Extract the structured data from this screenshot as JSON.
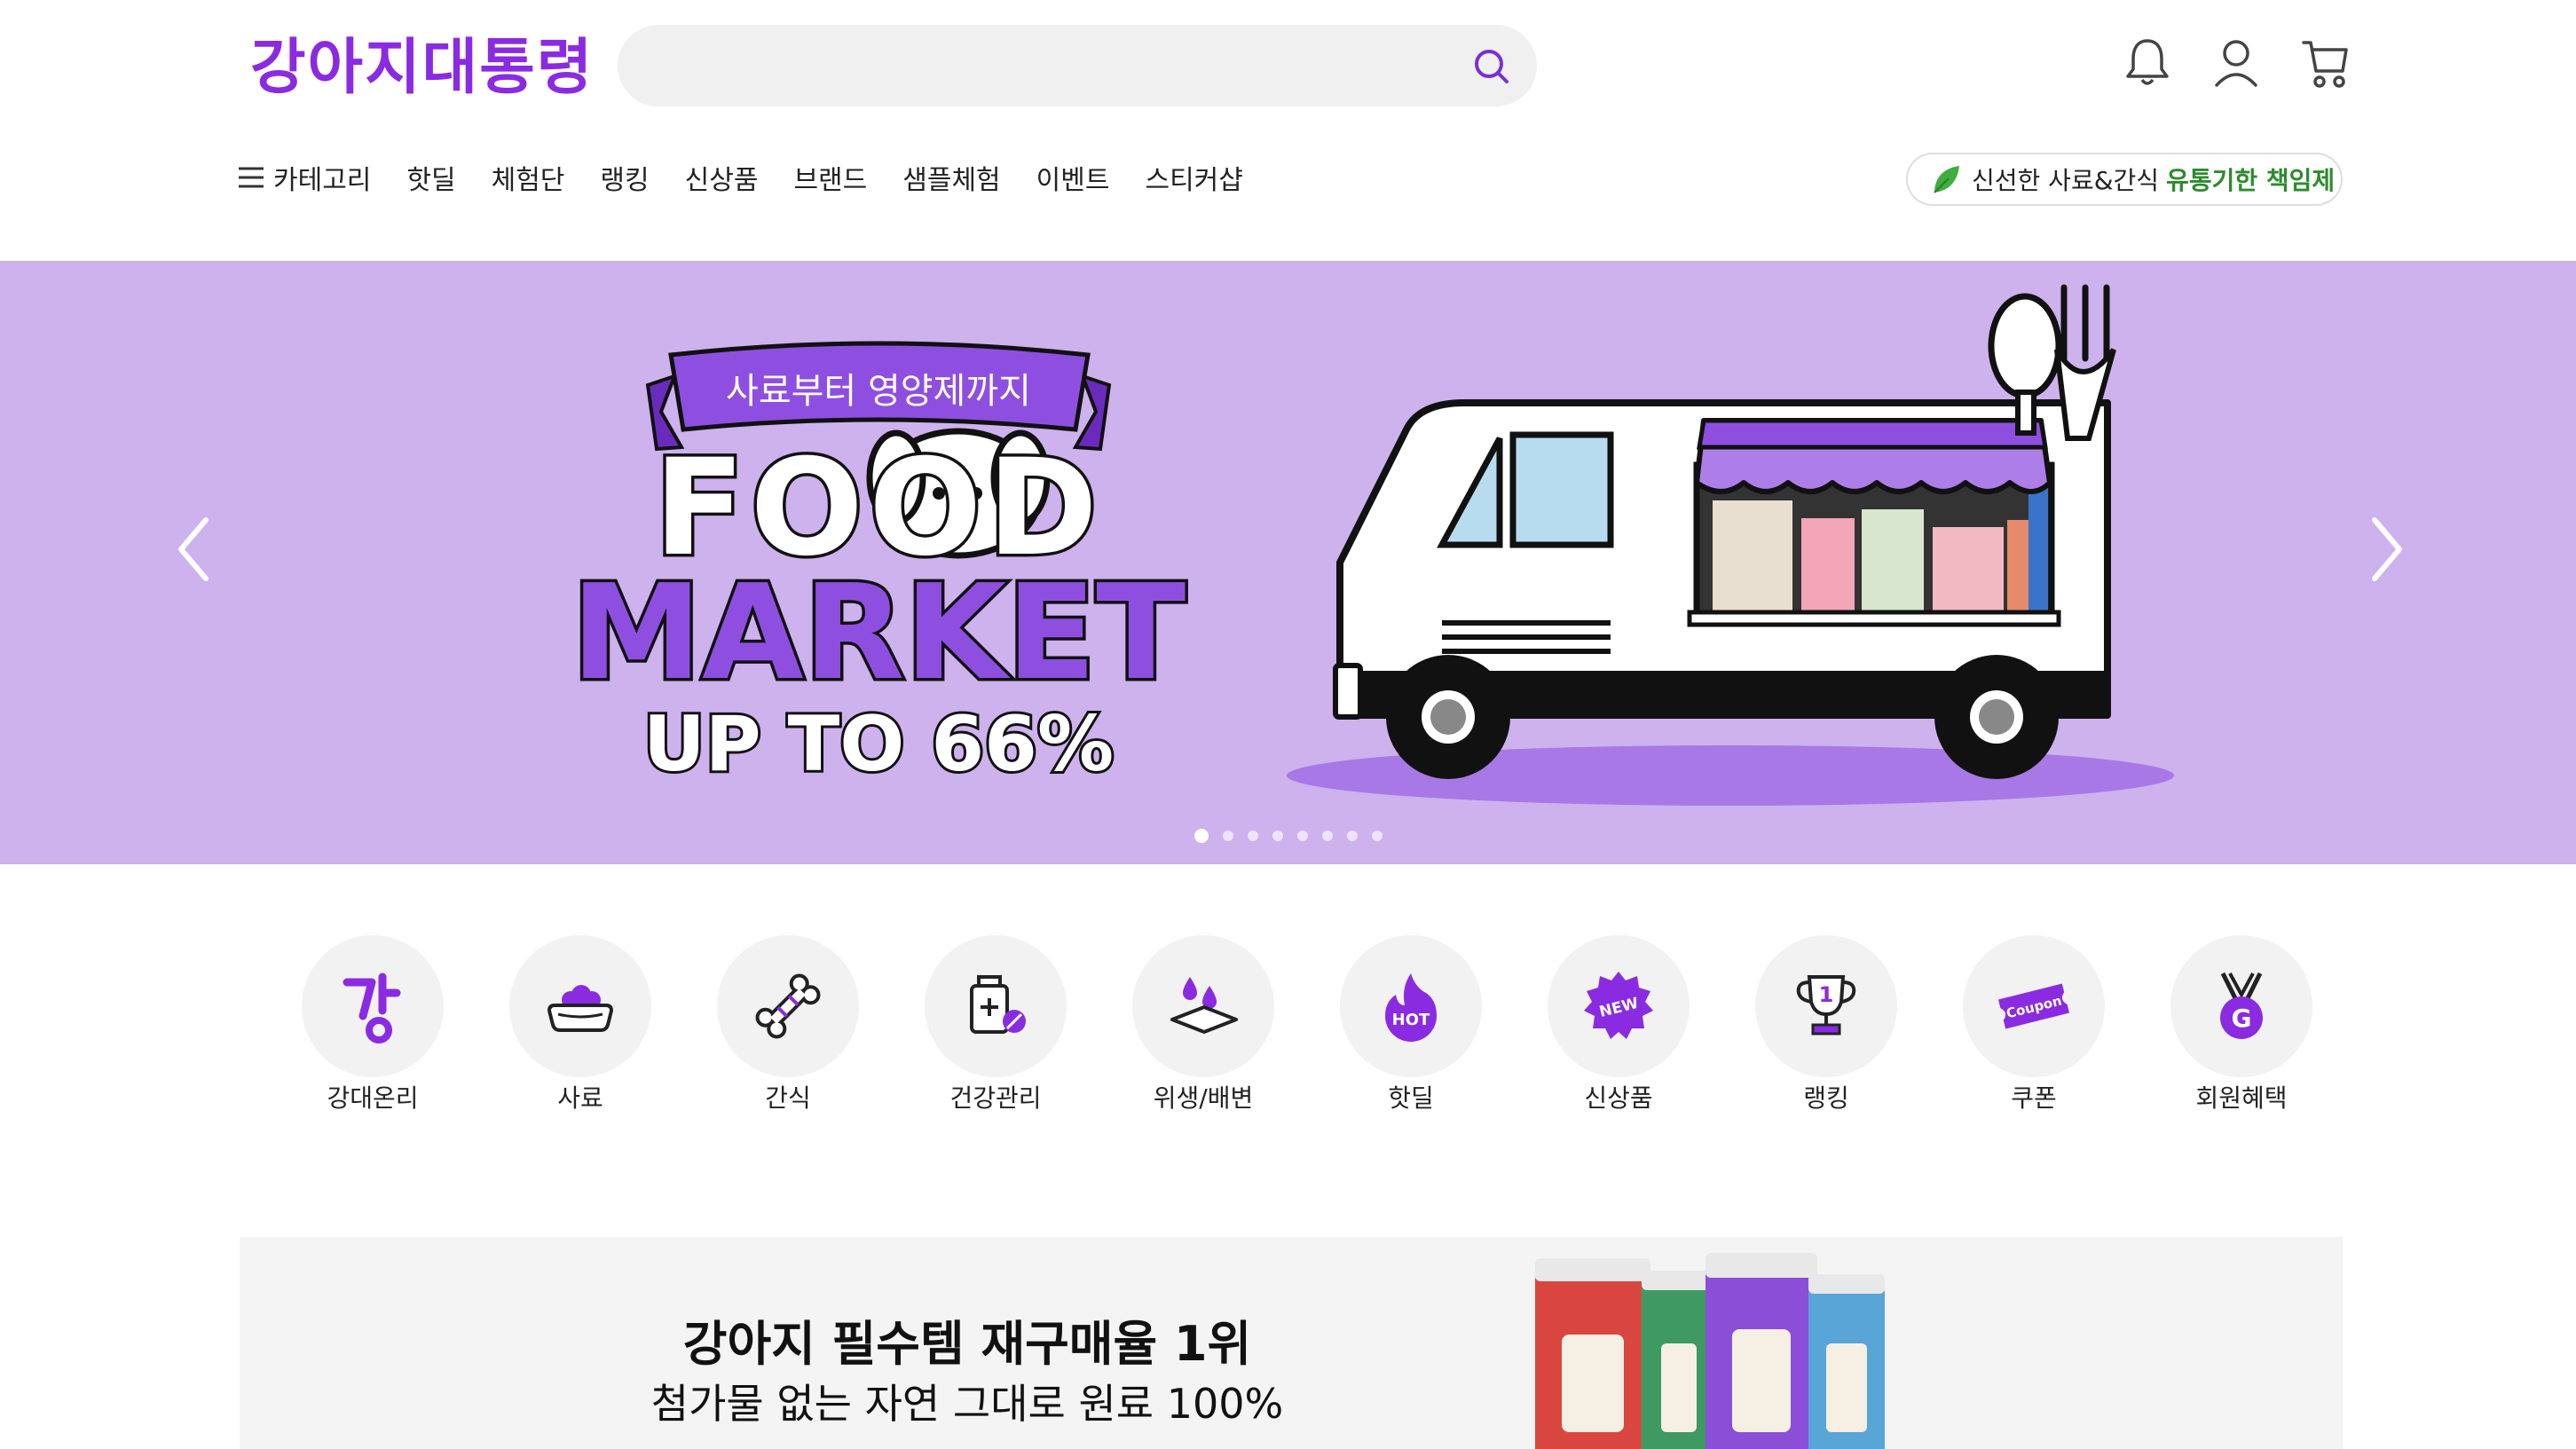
{
  "header": {
    "logo": "강아지대통령",
    "search_placeholder": "",
    "icons": [
      "bell-icon",
      "user-icon",
      "cart-icon"
    ]
  },
  "nav": {
    "items": [
      {
        "label": "카테고리",
        "icon": "hamburger-icon"
      },
      {
        "label": "핫딜"
      },
      {
        "label": "체험단"
      },
      {
        "label": "랭킹"
      },
      {
        "label": "신상품"
      },
      {
        "label": "브랜드"
      },
      {
        "label": "샘플체험"
      },
      {
        "label": "이벤트"
      },
      {
        "label": "스티커샵"
      }
    ],
    "fresh_badge": {
      "text": "신선한 사료&간식",
      "highlight": "유통기한 책임제",
      "icon": "leaf-icon"
    }
  },
  "banner": {
    "ribbon": "사료부터 영양제까지",
    "title_line1": "FOOD",
    "title_line2": "MARKET",
    "discount": "UP TO 66%",
    "slide_count": 8,
    "active_slide": 1,
    "background": "#cdb2ee",
    "accent": "#8e4fe0"
  },
  "categories": [
    {
      "label": "강대온리",
      "icon": "gang-logo-icon"
    },
    {
      "label": "사료",
      "icon": "food-bowl-icon"
    },
    {
      "label": "간식",
      "icon": "bone-icon"
    },
    {
      "label": "건강관리",
      "icon": "medicine-icon"
    },
    {
      "label": "위생/배변",
      "icon": "pee-pad-icon"
    },
    {
      "label": "핫딜",
      "icon": "hot-flame-icon",
      "badge": "HOT"
    },
    {
      "label": "신상품",
      "icon": "new-badge-icon",
      "badge": "NEW"
    },
    {
      "label": "랭킹",
      "icon": "trophy-icon",
      "badge": "1"
    },
    {
      "label": "쿠폰",
      "icon": "coupon-icon",
      "badge": "Coupon"
    },
    {
      "label": "회원혜택",
      "icon": "medal-icon",
      "badge": "G"
    }
  ],
  "promo": {
    "title": "강아지 필수템 재구매율 1위",
    "subtitle": "첨가물 없는 자연 그대로 원료 100%"
  },
  "colors": {
    "brand": "#8a2be2",
    "accent_purple": "#8e4fe0",
    "green": "#2e8b2e"
  }
}
